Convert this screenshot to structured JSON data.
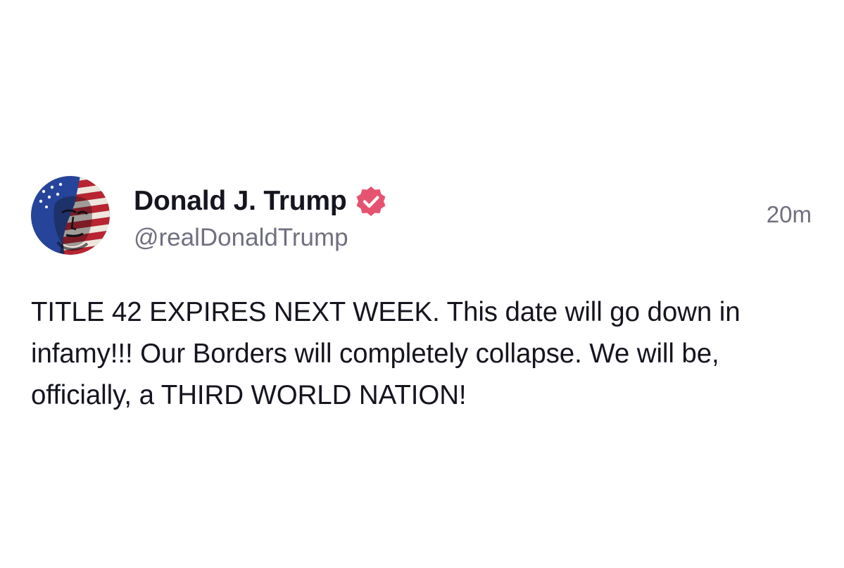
{
  "post": {
    "author": {
      "display_name": "Donald J. Trump",
      "handle": "@realDonaldTrump",
      "verified": true,
      "verified_badge_color": "#e5536f"
    },
    "timestamp": "20m",
    "body": "TITLE 42 EXPIRES NEXT WEEK. This date will go down in infamy!!! Our Borders will completely collapse. We will be, officially, a THIRD WORLD NATION!"
  }
}
